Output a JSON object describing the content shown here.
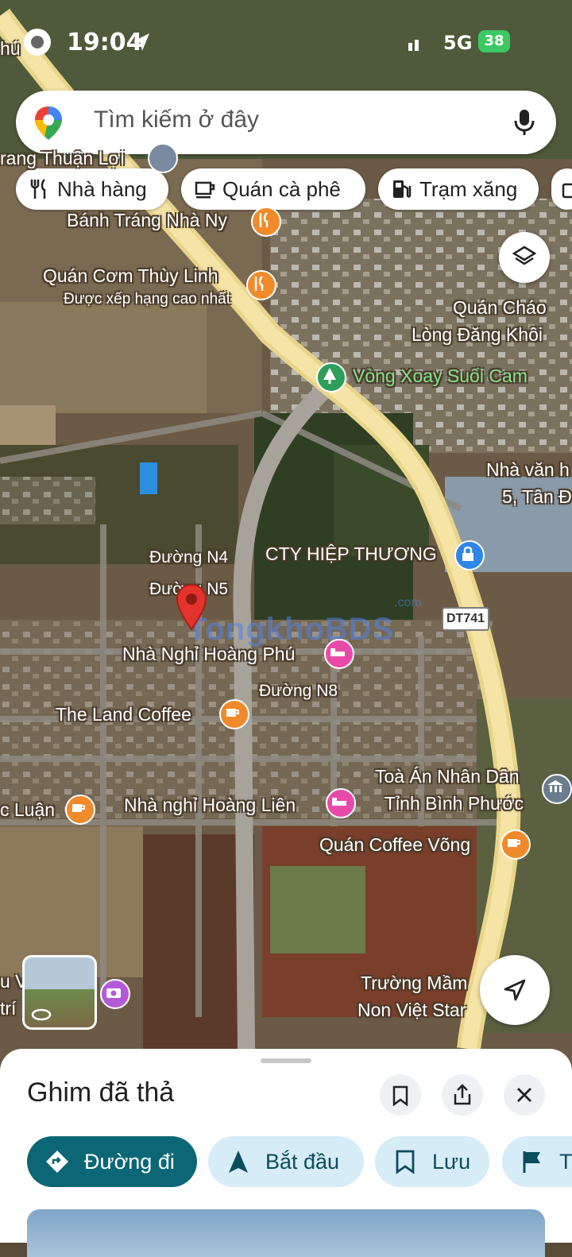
{
  "status_bar": {
    "time": "19:04",
    "network": "5G",
    "battery": "38"
  },
  "search": {
    "placeholder": "Tìm kiếm ở đây"
  },
  "chips": [
    {
      "label": "Nhà hàng",
      "icon": "fork-knife-icon"
    },
    {
      "label": "Quán cà phê",
      "icon": "coffee-cup-icon"
    },
    {
      "label": "Trạm xăng",
      "icon": "gas-pump-icon"
    }
  ],
  "map_labels": {
    "top_left_partial": "hú",
    "thuan_loi": "rang Thuận Lợi",
    "banh_trang": "Bánh Tráng Nhà Ny",
    "quan_com": "Quán Cơm Thùy Linh",
    "quan_com_sub": "Được xếp hạng cao nhất",
    "quan_chao_1": "Quán Cháo",
    "quan_chao_2": "Lòng Đăng Khôi",
    "vong_xoay": "Vòng Xoay Suối Cam",
    "nha_van_1": "Nhà văn h",
    "nha_van_2": "5, Tân Đ",
    "duong_n4": "Đường N4",
    "duong_n5": "Đường N5",
    "cty": "CTY HIỆP THƯƠNG",
    "dt741": "DT741",
    "watermark": "TongkhoBDS",
    "watermark_sub": ".com",
    "nha_nghi_hp": "Nhà Nghỉ Hoàng Phú",
    "duong_n8": "Đường N8",
    "land_coffee": "The Land Coffee",
    "toa_an_1": "Toà Án Nhân Dân",
    "toa_an_2": "Tỉnh Bình Phước",
    "c_luan": "c Luận",
    "nha_nghi_hl": "Nhà nghỉ Hoàng Liên",
    "coffee_vong": "Quán Coffee Võng",
    "truong_1": "Trường Mầm",
    "truong_2": "Non Việt Star",
    "left_partial_1": "u V",
    "left_partial_2": "trí"
  },
  "bottom_sheet": {
    "title": "Ghim đã thả",
    "actions": [
      {
        "label": "Đường đi",
        "icon": "directions-icon"
      },
      {
        "label": "Bắt đầu",
        "icon": "navigation-arrow-icon"
      },
      {
        "label": "Lưu",
        "icon": "bookmark-icon"
      },
      {
        "label": "T",
        "icon": "flag-icon"
      }
    ]
  },
  "colors": {
    "primary_action": "#0b6775",
    "secondary_action": "#d6ecf7",
    "pin": "#e3332c",
    "restaurant_poi": "#f08a2a",
    "lodging_poi": "#e94aa8",
    "road_major": "#f3dc8c"
  }
}
